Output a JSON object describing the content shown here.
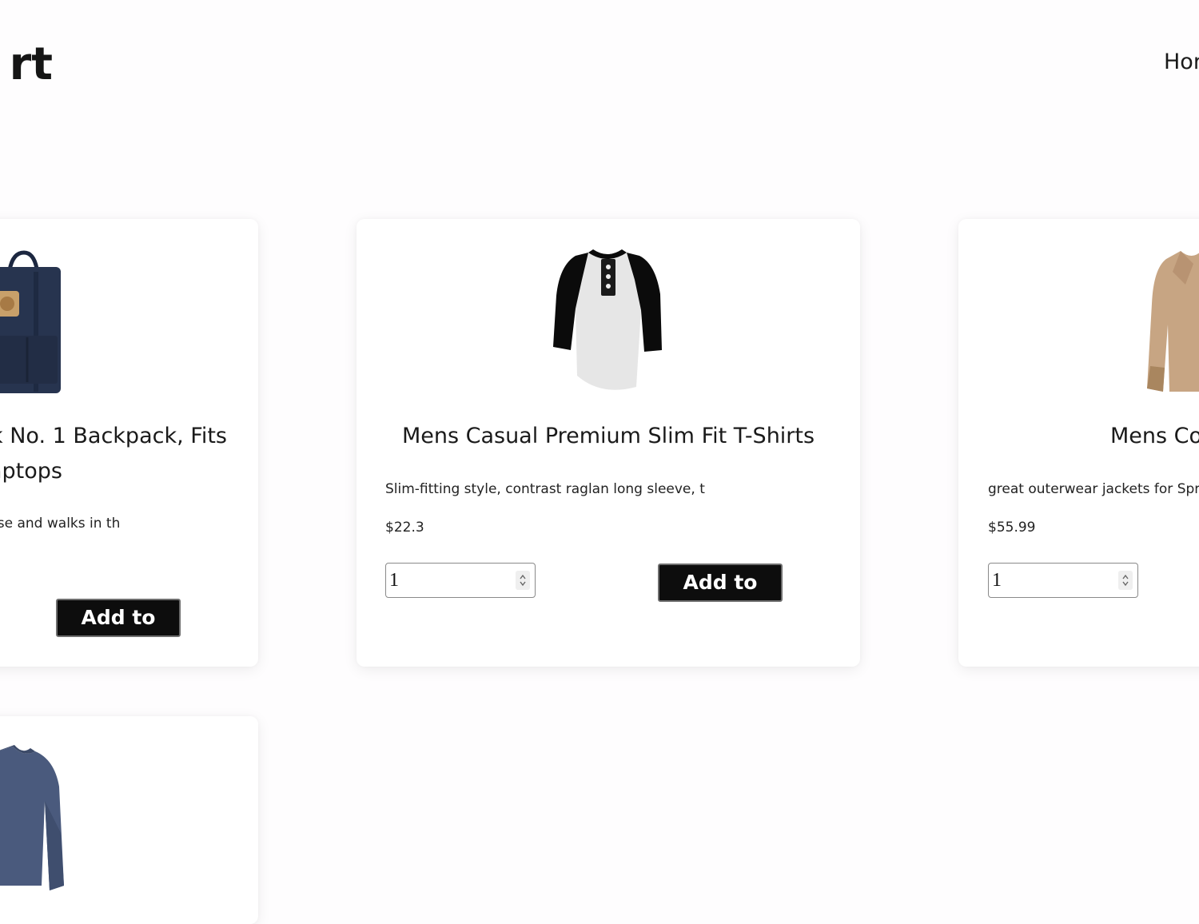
{
  "header": {
    "brand": "rt",
    "nav_home": "Hor"
  },
  "colors": {
    "button_bg": "#0d0d0d",
    "button_text": "#ffffff",
    "page_bg": "#fefdfe",
    "card_bg": "#ffffff"
  },
  "products": [
    {
      "title_line1": "k No. 1 Backpack, Fits",
      "title_line2": "aptops",
      "description": "use and walks in th",
      "button": "Add to cart",
      "icon": "backpack-image"
    },
    {
      "title": "Mens Casual Premium Slim Fit T-Shirts",
      "description": "Slim-fitting style, contrast raglan long sleeve, t",
      "price": "$22.3",
      "quantity": "1",
      "button": "Add to cart",
      "icon": "raglan-tshirt-image"
    },
    {
      "title": "Mens Co",
      "description": "great outerwear jackets for Spr",
      "price": "$55.99",
      "quantity": "1",
      "icon": "cotton-jacket-image"
    },
    {
      "icon": "longsleeve-shirt-image"
    }
  ]
}
